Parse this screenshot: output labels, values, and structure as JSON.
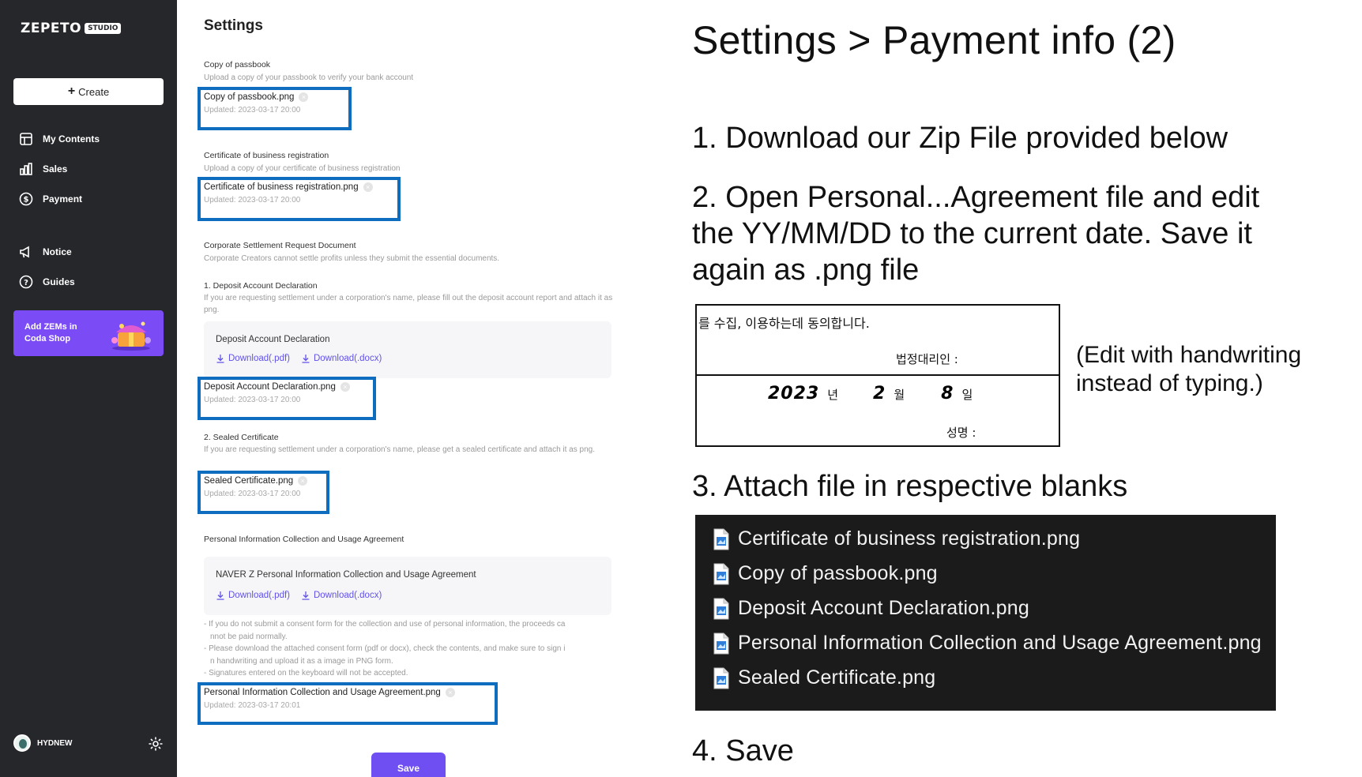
{
  "sidebar": {
    "logo_word": "ZEPETO",
    "logo_tag": "STUDIO",
    "create_label": "Create",
    "items": [
      {
        "label": "My Contents",
        "icon": "layout-icon"
      },
      {
        "label": "Sales",
        "icon": "bar-chart-icon"
      },
      {
        "label": "Payment",
        "icon": "dollar-circle-icon"
      },
      {
        "label": "Notice",
        "icon": "megaphone-icon"
      },
      {
        "label": "Guides",
        "icon": "question-circle-icon"
      }
    ],
    "promo_text": "Add ZEMs in Coda Shop",
    "username": "HYDNEW"
  },
  "settings": {
    "title": "Settings",
    "passbook": {
      "label": "Copy of passbook",
      "desc": "Upload a copy of your passbook to verify your bank account",
      "file": "Copy of passbook.png",
      "updated": "Updated: 2023-03-17 20:00"
    },
    "business": {
      "label": "Certificate of business registration",
      "desc": "Upload a copy of your certificate of business registration",
      "file": "Certificate of business registration.png",
      "updated": "Updated: 2023-03-17 20:00"
    },
    "corporate": {
      "label": "Corporate Settlement Request Document",
      "desc": "Corporate Creators cannot settle profits unless they submit the essential documents."
    },
    "deposit": {
      "label": "1. Deposit Account Declaration",
      "desc": "If you are requesting settlement under a corporation's name, please fill out the deposit account report and attach it as png.",
      "card_title": "Deposit Account Declaration",
      "download_pdf": "Download(.pdf)",
      "download_docx": "Download(.docx)",
      "file": "Deposit Account Declaration.png",
      "updated": "Updated: 2023-03-17 20:00"
    },
    "sealed": {
      "label": "2. Sealed Certificate",
      "desc": "If you are requesting settlement under a corporation's name, please get a sealed certificate and attach it as png.",
      "file": "Sealed Certificate.png",
      "updated": "Updated: 2023-03-17 20:00"
    },
    "personal": {
      "label": "Personal Information Collection and Usage Agreement",
      "card_title": "NAVER Z Personal Information Collection and Usage Agreement",
      "download_pdf": "Download(.pdf)",
      "download_docx": "Download(.docx)",
      "notes": [
        "- If you do not submit a consent form for the collection and use of personal information, the proceeds ca",
        "  nnot be paid normally.",
        "- Please download the attached consent form (pdf or docx), check the contents, and make sure to sign i",
        "  n handwriting and upload it as a image in PNG form.",
        "- Signatures entered on the keyboard will not be accepted."
      ],
      "file": "Personal Information Collection and Usage Agreement.png",
      "updated": "Updated: 2023-03-17 20:01"
    },
    "save_label": "Save"
  },
  "instructions": {
    "title": "Settings > Payment info (2)",
    "step1": "1. Download our Zip File provided below",
    "step2": "2. Open Personal...Agreement file and edit the YY/MM/DD to the current date. Save it again as .png file",
    "step3": "3. Attach file in respective blanks",
    "step4": "4. Save",
    "edit_note": "(Edit with handwriting instead of typing.)",
    "form": {
      "consent_line": "를 수집, 이용하는데 동의합니다.",
      "representative": "법정대리인 :",
      "year": "2023",
      "year_unit": "년",
      "month": "2",
      "month_unit": "월",
      "day": "8",
      "day_unit": "일",
      "name": "성명 :"
    },
    "files": [
      "Certificate of business registration.png",
      "Copy of passbook.png",
      "Deposit Account Declaration.png",
      "Personal Information Collection and Usage Agreement.png",
      "Sealed Certificate.png"
    ]
  },
  "colors": {
    "sidebar_bg": "#26272b",
    "accent": "#6f4ef2",
    "highlight": "#0e6dbf",
    "link": "#6152e8"
  }
}
